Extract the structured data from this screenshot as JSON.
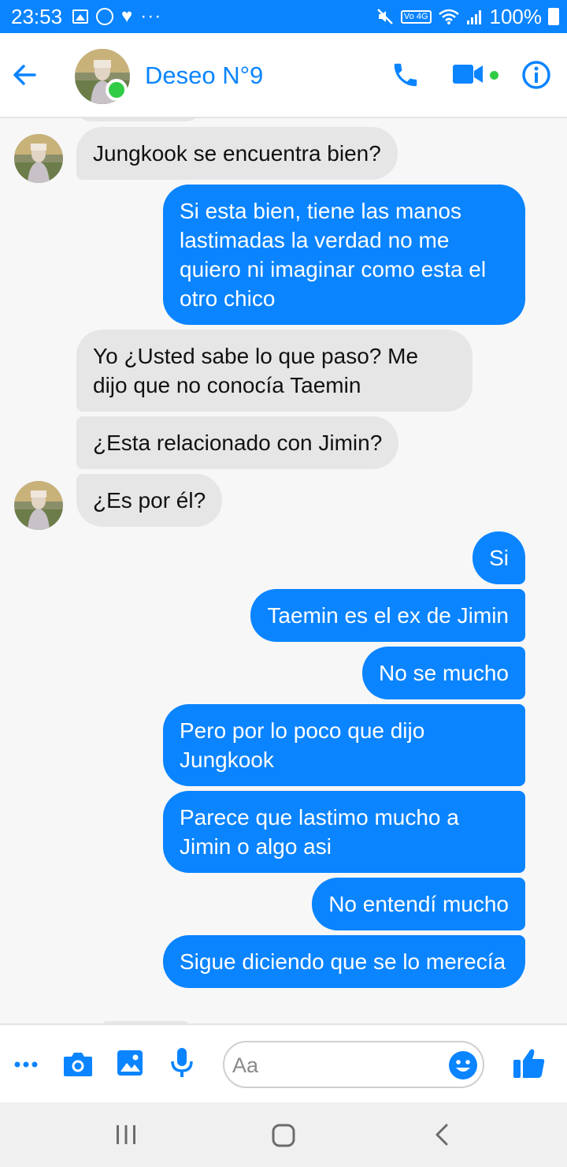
{
  "status_bar": {
    "time": "23:53",
    "battery": "100%",
    "network_badge": "Vo 4G",
    "overflow": "···",
    "bg_color": "#0a84ff"
  },
  "header": {
    "contact_name": "Deseo N°9",
    "online": true,
    "icons": [
      "back-arrow-icon",
      "phone-icon",
      "video-camera-icon",
      "info-icon"
    ],
    "accent_color": "#0a84ff",
    "online_color": "#31cc46"
  },
  "messages": [
    {
      "direction": "in",
      "text": "Jungkook se encuentra bien?"
    },
    {
      "direction": "out",
      "text": "Si esta bien, tiene las manos lastimadas la verdad no me quiero ni imaginar como esta el otro chico"
    },
    {
      "direction": "in",
      "text": "Yo ¿Usted sabe lo que paso? Me dijo que no conocía Taemin"
    },
    {
      "direction": "in",
      "text": "¿Esta relacionado con Jimin?"
    },
    {
      "direction": "in",
      "text": "¿Es por él?"
    },
    {
      "direction": "out",
      "text": "Si"
    },
    {
      "direction": "out",
      "text": "Taemin es el ex de Jimin"
    },
    {
      "direction": "out",
      "text": "No se mucho"
    },
    {
      "direction": "out",
      "text": "Pero por lo poco que dijo Jungkook"
    },
    {
      "direction": "out",
      "text": "Parece que lastimo mucho a Jimin o algo asi"
    },
    {
      "direction": "out",
      "text": "No entendí mucho"
    },
    {
      "direction": "out",
      "text": "Sigue diciendo que se lo merecía"
    }
  ],
  "composer": {
    "placeholder": "Aa",
    "icons": [
      "more-icon",
      "camera-icon",
      "image-icon",
      "microphone-icon",
      "emoji-icon",
      "thumbs-up-icon"
    ]
  },
  "navbar": {
    "icons": [
      "recent-apps-icon",
      "home-icon",
      "back-icon"
    ]
  },
  "colors": {
    "incoming_bubble": "#e6e6e6",
    "outgoing_bubble": "#0a84ff",
    "chat_background": "#f7f7f7"
  }
}
